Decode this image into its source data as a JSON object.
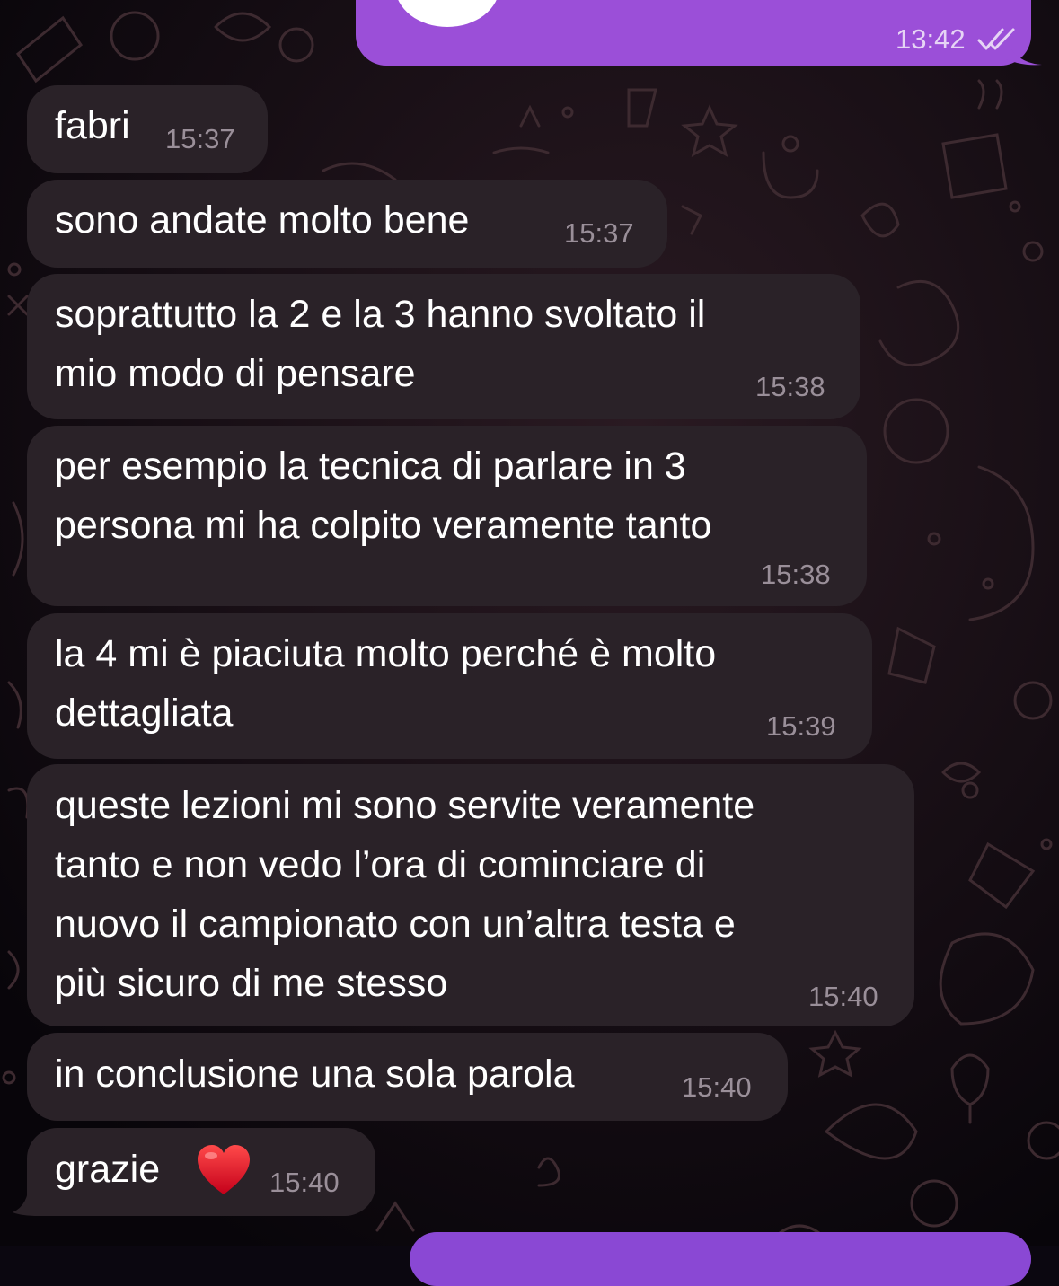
{
  "outgoing_top": {
    "time": "13:42",
    "status": "read-double-check"
  },
  "messages": [
    {
      "lines": [
        "fabri"
      ],
      "time": "15:37"
    },
    {
      "lines": [
        "sono andate molto bene"
      ],
      "time": "15:37"
    },
    {
      "lines": [
        "soprattutto la 2 e la 3 hanno svoltato il",
        "mio modo di pensare"
      ],
      "time": "15:38"
    },
    {
      "lines": [
        "per esempio la tecnica di parlare in 3",
        "persona mi ha colpito veramente tanto"
      ],
      "time": "15:38"
    },
    {
      "lines": [
        "la 4 mi è piaciuta molto perché è molto",
        "dettagliata"
      ],
      "time": "15:39"
    },
    {
      "lines": [
        "queste lezioni mi sono servite veramente",
        "tanto e non vedo l’ora di cominciare di",
        "nuovo il campionato con un’altra testa e",
        "più sicuro di me stesso"
      ],
      "time": "15:40"
    },
    {
      "lines": [
        "in conclusione una sola parola"
      ],
      "time": "15:40"
    },
    {
      "lines": [
        "grazie"
      ],
      "time": "15:40",
      "emoji": "heart-icon"
    }
  ],
  "colors": {
    "incoming_bubble": "#2a2228",
    "outgoing_bubble": "#9b4fd8",
    "background": "#0b0710",
    "timestamp_incoming": "#9a8f99",
    "timestamp_outgoing": "#e6d4f5"
  }
}
